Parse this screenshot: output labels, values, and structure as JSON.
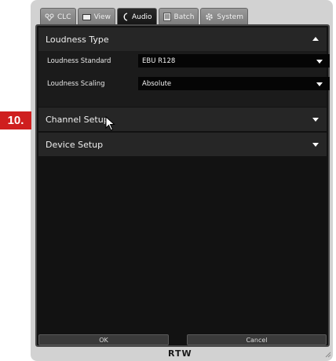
{
  "tabs": [
    {
      "label": "CLC",
      "icon": "clc-icon",
      "active": false
    },
    {
      "label": "View",
      "icon": "monitor-icon",
      "active": false
    },
    {
      "label": "Audio",
      "icon": "audio-icon",
      "active": true
    },
    {
      "label": "Batch",
      "icon": "batch-icon",
      "active": false
    },
    {
      "label": "System",
      "icon": "gear-icon",
      "active": false
    }
  ],
  "loudness_type": {
    "title": "Loudness Type",
    "expanded": true,
    "standard_label": "Loudness Standard",
    "standard_value": "EBU R128",
    "scaling_label": "Loudness Scaling",
    "scaling_value": "Absolute"
  },
  "channel_setup": {
    "title": "Channel Setup",
    "expanded": false
  },
  "device_setup": {
    "title": "Device Setup",
    "expanded": false
  },
  "footer": {
    "ok_label": "OK",
    "cancel_label": "Cancel",
    "logo": "RTW"
  },
  "step_badge": "10.",
  "colors": {
    "badge": "#cf1f1f",
    "panel": "#121212",
    "header": "#262626"
  }
}
